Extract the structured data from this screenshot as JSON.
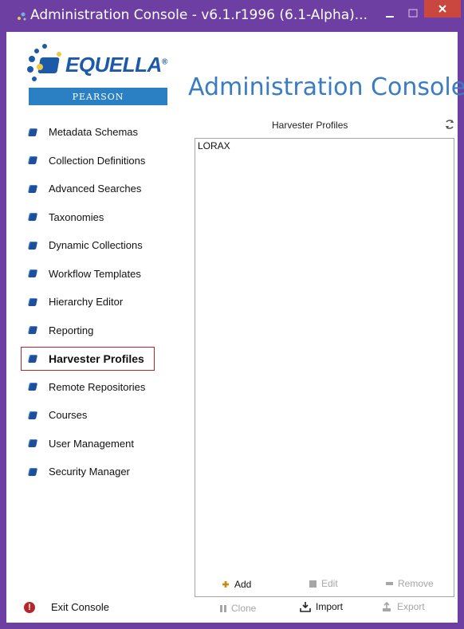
{
  "window": {
    "title": "Administration Console - v6.1.r1996 (6.1-Alpha)..."
  },
  "logo": {
    "brand": "EQUELLA",
    "sub_brand": "PEARSON"
  },
  "header": {
    "title": "Administration Console"
  },
  "sidebar": {
    "items": [
      {
        "label": "Metadata Schemas",
        "active": false
      },
      {
        "label": "Collection Definitions",
        "active": false
      },
      {
        "label": "Advanced Searches",
        "active": false
      },
      {
        "label": "Taxonomies",
        "active": false
      },
      {
        "label": "Dynamic Collections",
        "active": false
      },
      {
        "label": "Workflow Templates",
        "active": false
      },
      {
        "label": "Hierarchy Editor",
        "active": false
      },
      {
        "label": "Reporting",
        "active": false
      },
      {
        "label": "Harvester Profiles",
        "active": true
      },
      {
        "label": "Remote Repositories",
        "active": false
      },
      {
        "label": "Courses",
        "active": false
      },
      {
        "label": "User Management",
        "active": false
      },
      {
        "label": "Security Manager",
        "active": false
      }
    ],
    "exit_label": "Exit Console"
  },
  "panel": {
    "title": "Harvester Profiles",
    "items": [
      "LORAX"
    ]
  },
  "actions": {
    "add": "Add",
    "edit": "Edit",
    "remove": "Remove",
    "clone": "Clone",
    "import": "Import",
    "export": "Export"
  },
  "colors": {
    "titlebar": "#6e3fa3",
    "accent": "#3a7cc2",
    "active_outline": "#b3262c",
    "close_button": "#c9473f"
  }
}
